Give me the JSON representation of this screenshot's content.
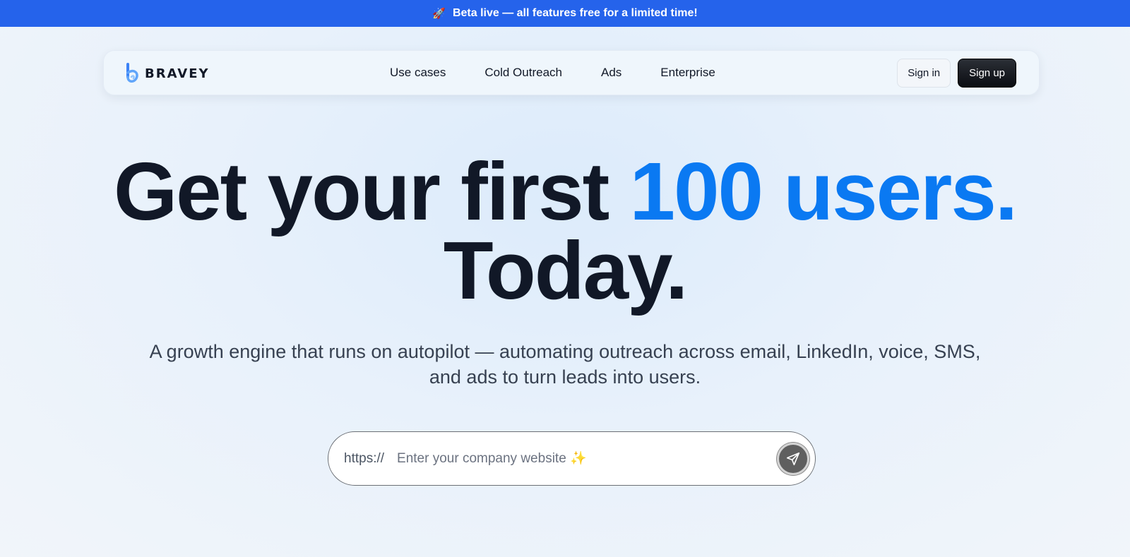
{
  "announcement": {
    "icon": "rocket-icon",
    "text": "Beta live — all features free for a limited time!"
  },
  "nav": {
    "brand": "BRAVEY",
    "menu": [
      "Use cases",
      "Cold Outreach",
      "Ads",
      "Enterprise"
    ],
    "signin": "Sign in",
    "signup": "Sign up"
  },
  "hero": {
    "line1": "Get your first",
    "line1_accent": "100 users.",
    "line2": "Today.",
    "subtitle": "A growth engine that runs on autopilot — automating outreach across email, LinkedIn, voice, SMS, and ads to turn leads into users."
  },
  "search": {
    "prefix": "https://",
    "placeholder": "Enter your company website ✨",
    "value": "",
    "submit_icon": "send-icon"
  },
  "colors": {
    "banner": "#2563eb",
    "accent": "#0a79f2",
    "text": "#111827"
  }
}
